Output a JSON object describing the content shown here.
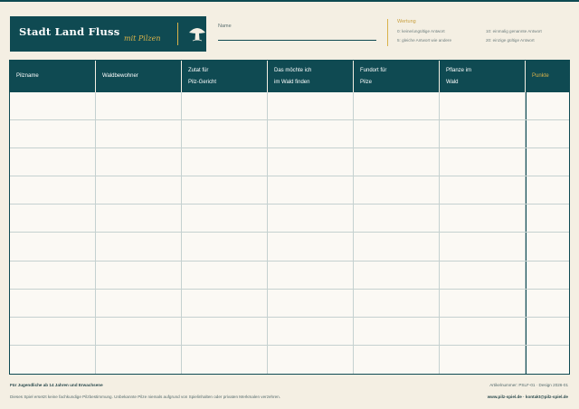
{
  "header": {
    "title": "Stadt Land Fluss",
    "subtitle": "mit Pilzen",
    "name_label": "Name"
  },
  "scoring": {
    "title": "Wertung",
    "items": [
      "0: keine/ungültige Antwort",
      "10: einmalig genannte Antwort",
      "5: gleiche Antwort wie andere",
      "20: einzige gültige Antwort"
    ]
  },
  "table": {
    "columns": [
      {
        "line1": "Pilzname",
        "line2": ""
      },
      {
        "line1": "Waldbewohner",
        "line2": ""
      },
      {
        "line1": "Zutat für",
        "line2": "Pilz-Gericht"
      },
      {
        "line1": "Das möchte ich",
        "line2": "im Wald finden"
      },
      {
        "line1": "Fundort für",
        "line2": "Pilze"
      },
      {
        "line1": "Pflanze im",
        "line2": "Wald"
      },
      {
        "line1": "Punkte",
        "line2": ""
      }
    ],
    "row_count": 10
  },
  "footer": {
    "left_line1": "Für Jugendliche ab 14 Jahren und Erwachsene",
    "left_line2": "Dieses Spiel ersetzt keine fachkundige Pilzbestimmung. Unbekannte Pilze niemals aufgrund von Spielinhalten oder privaten Merkmalen verzehren.",
    "right_line1": "Artikelnummer: PSLF-01 · Design 2026-01",
    "right_line2": "www.pilz-spiel.de · kontakt@pilz-spiel.de"
  },
  "colors": {
    "primary": "#0f4a52",
    "accent": "#d9b24a",
    "background": "#f4efe3"
  }
}
